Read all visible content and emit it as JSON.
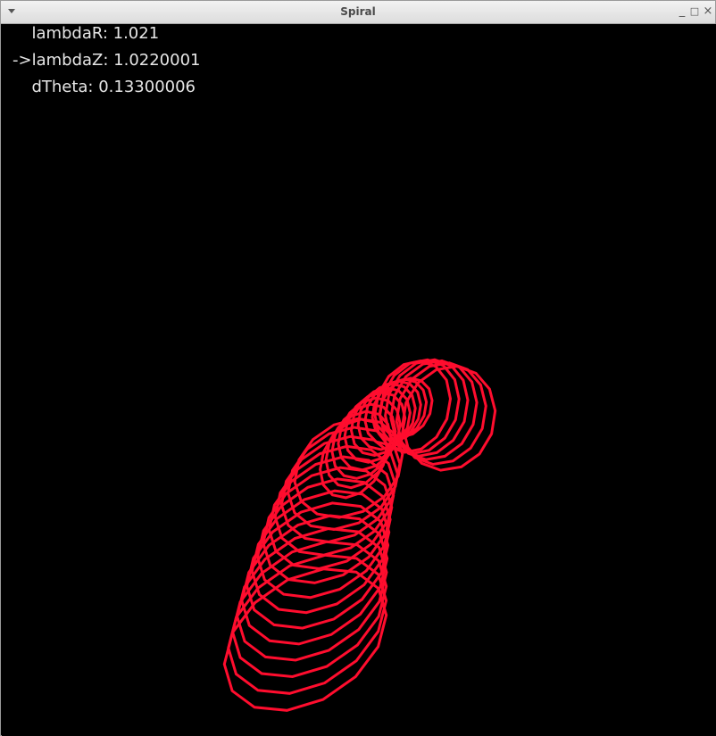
{
  "window": {
    "title": "Spiral"
  },
  "params": [
    {
      "text": "  lambdaR: 1.021"
    },
    {
      "text": "->lambdaZ: 1.0220001"
    },
    {
      "text": "  dTheta: 0.13300006"
    }
  ],
  "colors": {
    "background": "#000000",
    "spiral": "#ff0d2e",
    "text": "#e6e6e6"
  },
  "icons": {
    "menu": "chevron-down-icon",
    "minimize": "minimize-icon",
    "maximize": "maximize-icon",
    "close": "close-icon"
  }
}
